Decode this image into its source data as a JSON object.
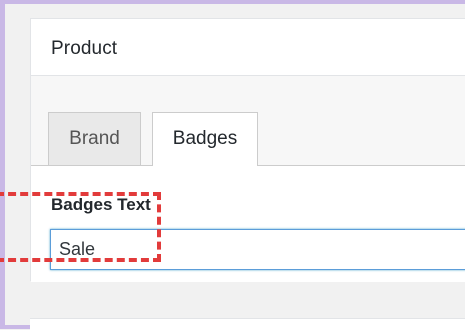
{
  "panel": {
    "title": "Product"
  },
  "tabs": [
    {
      "label": "Brand",
      "active": false
    },
    {
      "label": "Badges",
      "active": true
    }
  ],
  "badges_field": {
    "label": "Badges Text",
    "value": "Sale"
  },
  "colors": {
    "highlight": "#e23b3b",
    "input_focus_border": "#5b9dd9",
    "frame": "#c9b8e6"
  }
}
